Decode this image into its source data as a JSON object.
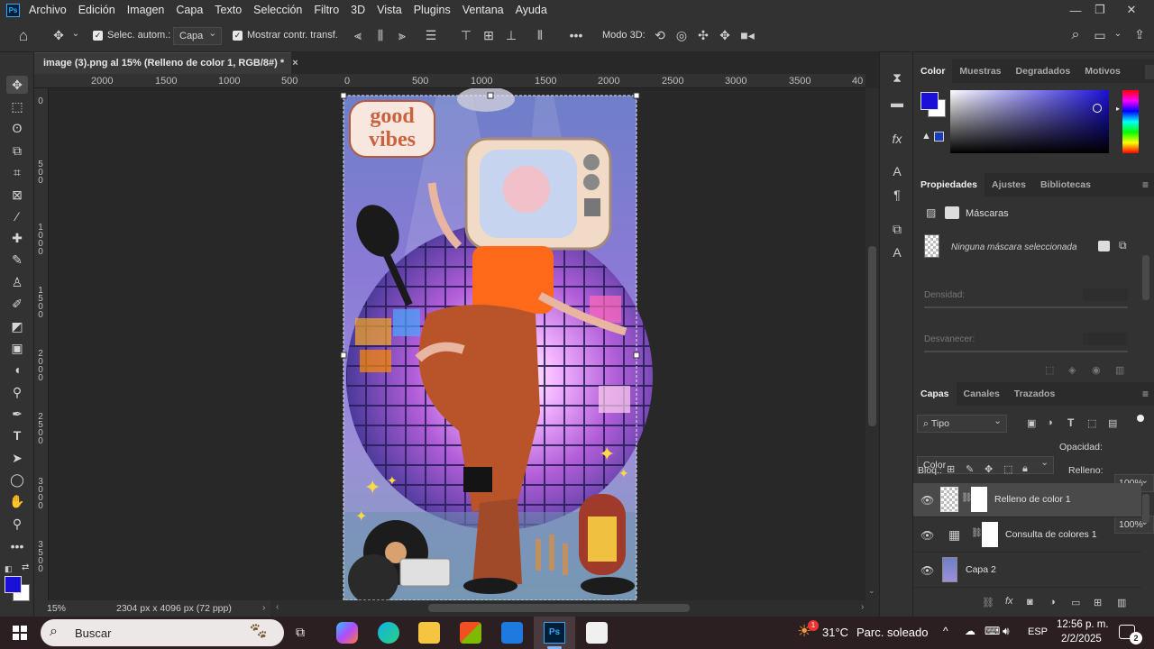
{
  "app": {
    "logo_text": "Ps",
    "menu": [
      "Archivo",
      "Edición",
      "Imagen",
      "Capa",
      "Texto",
      "Selección",
      "Filtro",
      "3D",
      "Vista",
      "Plugins",
      "Ventana",
      "Ayuda"
    ]
  },
  "options": {
    "auto_select_label": "Selec. autom.:",
    "auto_select_value": "Capa",
    "transform_label": "Mostrar contr. transf.",
    "mode3d_label": "Modo 3D:"
  },
  "document": {
    "tab_title": "image (3).png al 15% (Relleno de color 1, RGB/8#) *",
    "zoom": "15%",
    "size_info": "2304 px x 4096 px (72 ppp)"
  },
  "ruler": {
    "top_labels": [
      "2000",
      "1500",
      "1000",
      "500",
      "0",
      "500",
      "1000",
      "1500",
      "2000",
      "2500",
      "3000",
      "3500",
      "40"
    ],
    "left_labels": [
      "0",
      "5\n0\n0",
      "1\n0\n0\n0",
      "1\n5\n0\n0",
      "2\n0\n0\n0",
      "2\n5\n0\n0",
      "3\n0\n0\n0",
      "3\n5\n0\n0"
    ]
  },
  "artwork": {
    "sticker_line1": "good",
    "sticker_line2": "vibes"
  },
  "panels": {
    "color_tabs": [
      "Color",
      "Muestras",
      "Degradados",
      "Motivos"
    ],
    "foreground_color": "#1a10d8",
    "props_tabs": [
      "Propiedades",
      "Ajustes",
      "Bibliotecas"
    ],
    "masks_label": "Máscaras",
    "no_mask": "Ninguna máscara seleccionada",
    "density_label": "Densidad:",
    "feather_label": "Desvanecer:",
    "layers_tabs": [
      "Capas",
      "Canales",
      "Trazados"
    ],
    "filter_value": "Tipo",
    "blend_mode": "Color",
    "opacity_label": "Opacidad:",
    "opacity_value": "100%",
    "lock_label": "Bloq.:",
    "fill_label": "Relleno:",
    "fill_value": "100%",
    "layers": [
      {
        "name": "Relleno de color 1",
        "selected": true
      },
      {
        "name": "Consulta de colores 1",
        "selected": false
      },
      {
        "name": "Capa 2",
        "selected": false
      }
    ]
  },
  "taskbar": {
    "search_label": "Buscar",
    "weather_temp": "31°C",
    "weather_desc": "Parc. soleado",
    "weather_badge": "1",
    "language": "ESP",
    "time": "12:56 p. m.",
    "date": "2/2/2025",
    "notif_count": "2"
  }
}
